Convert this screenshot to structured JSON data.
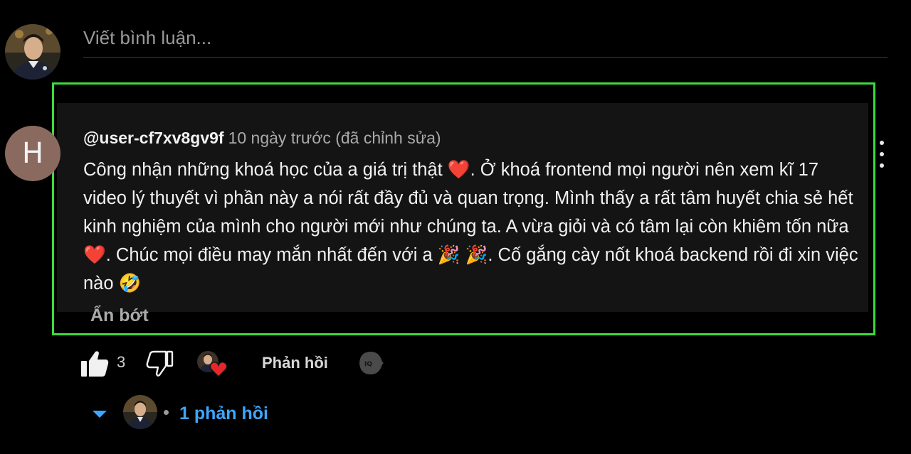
{
  "composer": {
    "placeholder": "Viết bình luận..."
  },
  "comment": {
    "author": "@user-cf7xv8gv9f",
    "timestamp": "10 ngày trước (đã chỉnh sửa)",
    "avatar_letter": "H",
    "body": "Công nhận những khoá học của a giá trị thật ❤️. Ở khoá frontend mọi người nên xem kĩ 17 video lý thuyết vì phần này a nói rất đầy đủ và quan trọng. Mình thấy a rất tâm huyết chia sẻ hết kinh nghiệm của mình cho người mới như chúng ta. A vừa giỏi và có tâm lại còn khiêm tốn nữa ❤️. Chúc mọi điều may mắn nhất đến với a 🎉 🎉. Cố gắng cày nốt khoá backend rồi đi xin việc nào 🤣",
    "show_less_label": "Ẩn bớt",
    "like_count": "3",
    "reply_label": "Phản hồi",
    "replies_label": "1 phản hồi"
  },
  "colors": {
    "highlight_border": "#3edb3c",
    "accent_link": "#3ea6ff",
    "heart": "#e5272c",
    "author_avatar_bg": "#8a6a5f"
  },
  "icons": {
    "like": "thumb-up-icon",
    "dislike": "thumb-down-icon",
    "creator_heart": "creator-heart-icon",
    "more": "more-vertical-icon",
    "iq": "iq-icon",
    "expand": "caret-down-icon"
  }
}
